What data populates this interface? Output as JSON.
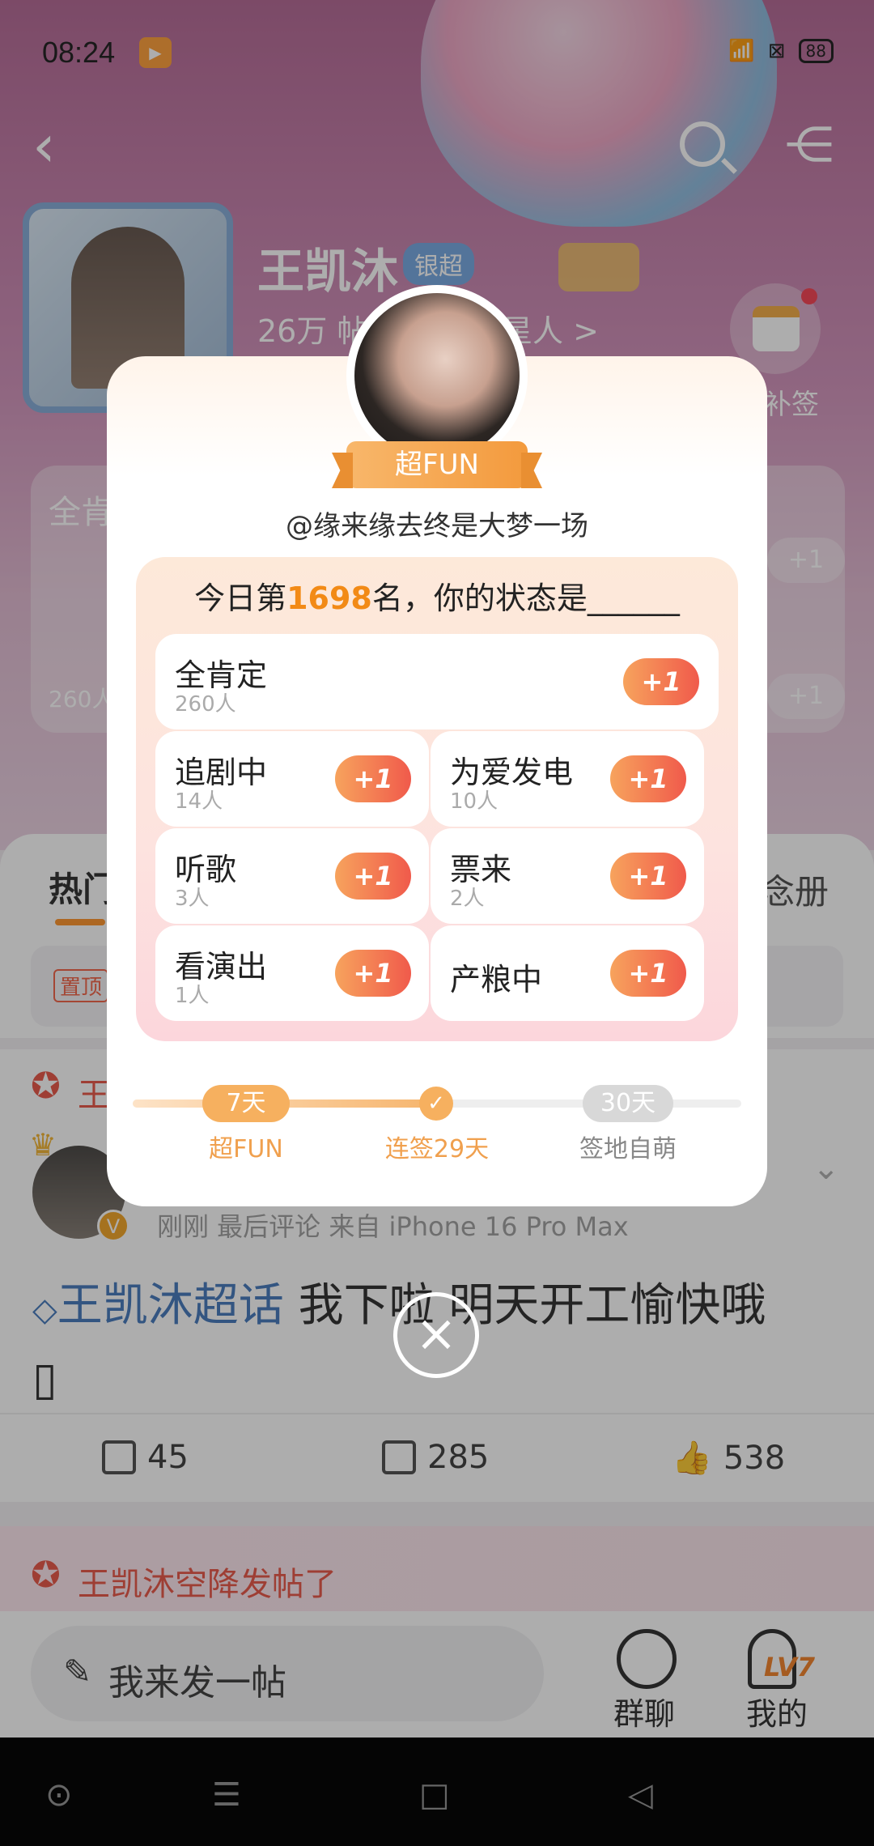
{
  "status_bar": {
    "time": "08:24",
    "app_badge": "Video",
    "battery": "88"
  },
  "header": {
    "name": "王凯沐",
    "level_badge": "银超",
    "stats": "26万 帖",
    "stats_tail": "星人 >",
    "checkin_label": "补签"
  },
  "bg_card": {
    "title": "全肯",
    "count": "260人",
    "plus": "+1"
  },
  "tabs": {
    "hot": "热门",
    "album": "念册"
  },
  "pinned": {
    "badge": "置顶"
  },
  "notice": {
    "title": "王"
  },
  "post": {
    "meta": "刚刚  最后评论   来自 iPhone 16 Pro Max",
    "topic": "王凯沐超话",
    "text": "  我下啦 明天开工愉快哦",
    "second_line": "▯",
    "actions": {
      "repost": "45",
      "comment": "285",
      "like": "538"
    }
  },
  "notice2": {
    "text": "王凯沐空降发帖了"
  },
  "bottom": {
    "compose": "我来发一帖",
    "group": "群聊",
    "me": "我的",
    "me_level": "LV7"
  },
  "dialog": {
    "ribbon": "超FUN",
    "user": "@缘来缘去终是大梦一场",
    "title_prefix": "今日第",
    "rank": "1698",
    "title_suffix": "名，你的状态是______",
    "plus_label": "+1",
    "options": [
      {
        "name": "全肯定",
        "count": "260人"
      },
      {
        "name": "追剧中",
        "count": "14人"
      },
      {
        "name": "为爱发电",
        "count": "10人"
      },
      {
        "name": "听歌",
        "count": "3人"
      },
      {
        "name": "票来",
        "count": "2人"
      },
      {
        "name": "看演出",
        "count": "1人"
      },
      {
        "name": "产粮中",
        "count": ""
      }
    ],
    "progress": {
      "start_pill": "7天",
      "start_label": "超FUN",
      "mid_label": "连签29天",
      "end_pill": "30天",
      "end_label": "签地自萌",
      "streak_days": 29,
      "goal_days": 30
    }
  },
  "colors": {
    "accent": "#f28a16",
    "plus_start": "#f7a35d",
    "plus_end": "#f05a4b",
    "topic": "#3a72b8"
  }
}
